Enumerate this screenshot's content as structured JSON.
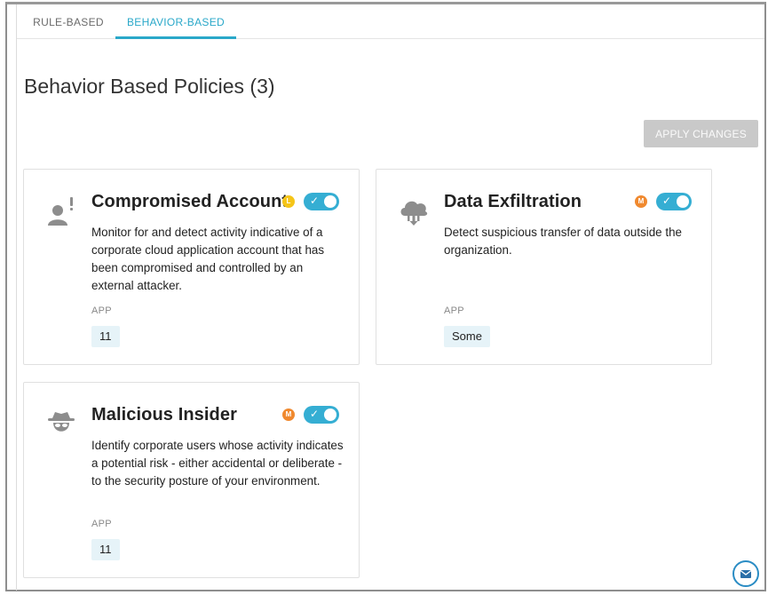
{
  "tabs": [
    {
      "label": "RULE-BASED",
      "active": false
    },
    {
      "label": "BEHAVIOR-BASED",
      "active": true
    }
  ],
  "page_title": "Behavior Based Policies (3)",
  "apply_button": "APPLY CHANGES",
  "colors": {
    "accent": "#2aa8c9",
    "toggle_on": "#35aed3",
    "badge_low": "#f5c518",
    "badge_medium": "#f0892f"
  },
  "policies": [
    {
      "title": "Compromised Account",
      "icon": "user-alert-icon",
      "severity_badge": "L",
      "enabled": true,
      "description": "Monitor for and detect activity indicative of a corporate cloud application account that has been compromised and controlled by an external attacker.",
      "app_label": "APP",
      "app_value": "11"
    },
    {
      "title": "Data Exfiltration",
      "icon": "cloud-download-icon",
      "severity_badge": "M",
      "enabled": true,
      "description": "Detect suspicious transfer of data outside the organization.",
      "app_label": "APP",
      "app_value": "Some"
    },
    {
      "title": "Malicious Insider",
      "icon": "spy-icon",
      "severity_badge": "M",
      "enabled": true,
      "description": "Identify corporate users whose activity indicates a potential risk - either accidental or deliberate - to the security posture of your environment.",
      "app_label": "APP",
      "app_value": "11"
    }
  ],
  "fab_icon": "mail-icon"
}
